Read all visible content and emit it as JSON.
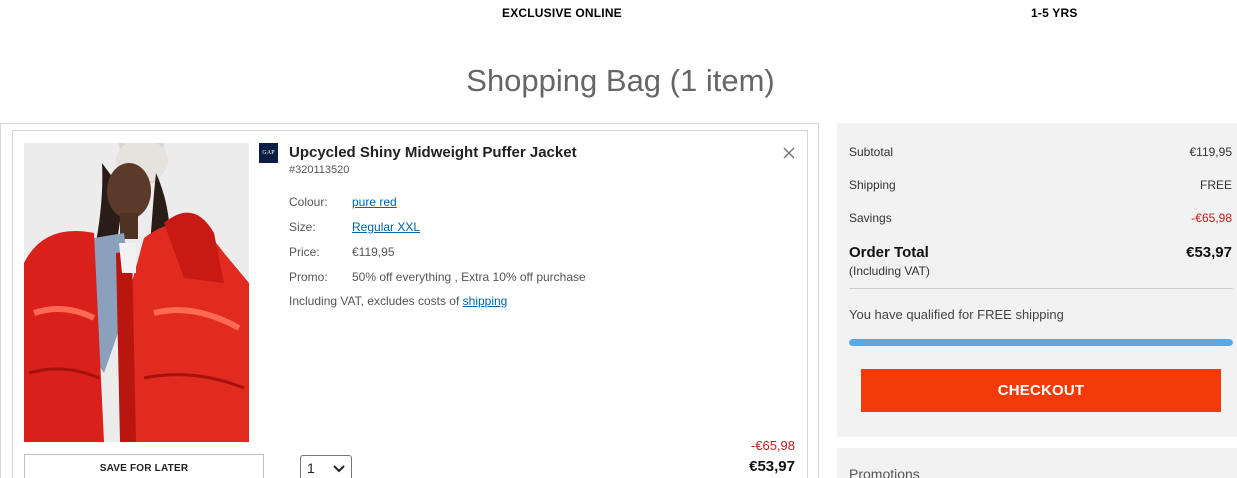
{
  "banner": {
    "left_text": "EXCLUSIVE ONLINE",
    "right_text": "1-5 YRS"
  },
  "page": {
    "title": "Shopping Bag (1 item)"
  },
  "item": {
    "brand_logo_text": "GAP",
    "name": "Upcycled Shiny Midweight Puffer Jacket",
    "sku": "#320113520",
    "colour_label": "Colour:",
    "colour_value": "pure red",
    "size_label": "Size:",
    "size_value": "Regular XXL",
    "price_label": "Price:",
    "price_value": "€119,95",
    "promo_label": "Promo:",
    "promo_value": "50% off everything , Extra 10% off purchase",
    "vat_note": "Including VAT, excludes costs of ",
    "vat_link": "shipping",
    "savings": "-€65,98",
    "total": "€53,97",
    "save_for_later": "SAVE FOR LATER",
    "quantity": "1"
  },
  "summary": {
    "subtotal_label": "Subtotal",
    "subtotal_value": "€119,95",
    "shipping_label": "Shipping",
    "shipping_value": "FREE",
    "savings_label": "Savings",
    "savings_value": "-€65,98",
    "order_total_label": "Order Total",
    "order_total_vat": "(Including VAT)",
    "order_total_value": "€53,97",
    "shipping_message": "You have qualified for FREE shipping",
    "shipping_progress_percent": 100,
    "checkout_label": "CHECKOUT"
  },
  "promotions": {
    "title": "Promotions"
  },
  "colors": {
    "checkout": "#f23b08",
    "savings_red": "#c11a1a",
    "link_blue": "#0062a8",
    "progress_blue": "#5aa8e6",
    "gap_navy": "#0b1e44"
  }
}
